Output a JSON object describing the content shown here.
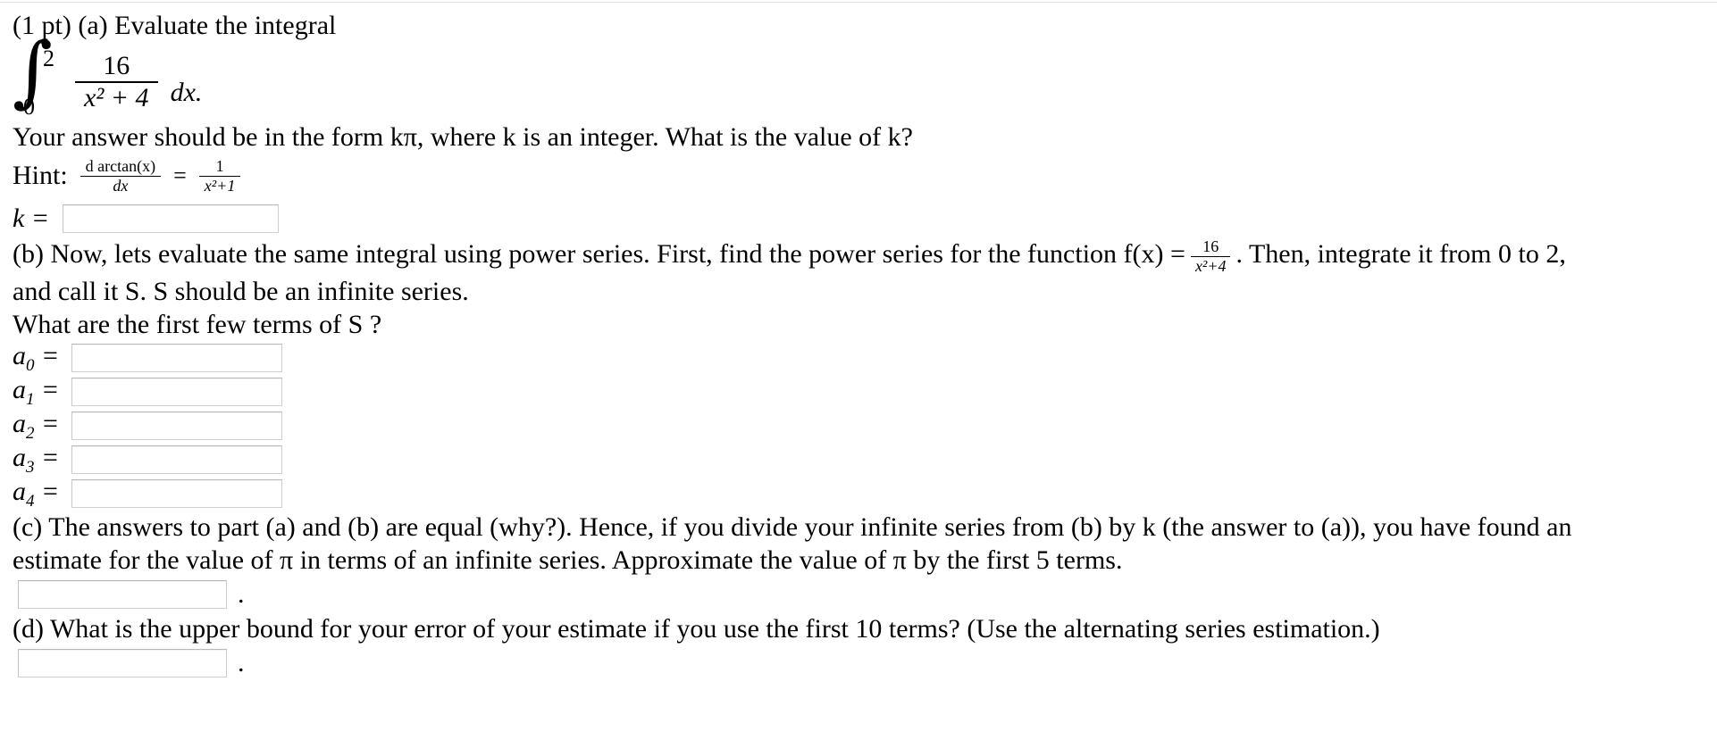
{
  "problem": {
    "points_label": "(1 pt)",
    "part_a": {
      "prompt": "(a) Evaluate the integral",
      "integral": {
        "sign": "∫",
        "lower_limit": "0",
        "upper_limit": "2",
        "numerator": "16",
        "denominator": "x² + 4",
        "differential": "dx."
      },
      "form_instruction": "Your answer should be in the form kπ, where k is an integer. What is the value of k?",
      "hint_label": "Hint:",
      "hint": {
        "left_numerator": "d arctan(x)",
        "left_denominator": "dx",
        "equals": "=",
        "right_numerator": "1",
        "right_denominator": "x²+1"
      },
      "answer_label": "k =",
      "answer_value": ""
    },
    "part_b": {
      "text_before_fraction": "(b) Now, lets evaluate the same integral using power series. First, find the power series for the function f(x) =",
      "fraction": {
        "numerator": "16",
        "denominator": "x²+4"
      },
      "text_after_fraction": ". Then, integrate it from 0 to 2,",
      "line2": "and call it S. S should be an infinite series.",
      "line3": "What are the first few terms of S ?",
      "coefficients": [
        {
          "label": "a",
          "subscript": "0",
          "equals": "=",
          "value": ""
        },
        {
          "label": "a",
          "subscript": "1",
          "equals": "=",
          "value": ""
        },
        {
          "label": "a",
          "subscript": "2",
          "equals": "=",
          "value": ""
        },
        {
          "label": "a",
          "subscript": "3",
          "equals": "=",
          "value": ""
        },
        {
          "label": "a",
          "subscript": "4",
          "equals": "=",
          "value": ""
        }
      ]
    },
    "part_c": {
      "line1": "(c) The answers to part (a) and (b) are equal (why?). Hence, if you divide your infinite series from (b) by k (the answer to (a)), you have found an",
      "line2": "estimate for the value of π in terms of an infinite series. Approximate the value of π by the first 5 terms.",
      "answer_value": "",
      "trailing_punctuation": "."
    },
    "part_d": {
      "line1": "(d) What is the upper bound for your error of your estimate if you use the first 10 terms? (Use the alternating series estimation.)",
      "answer_value": "",
      "trailing_punctuation": "."
    }
  },
  "style": {
    "page_background": "#ffffff",
    "text_color": "#000000",
    "input_border_color": "#cfcfcf",
    "top_rule_color": "#e3e3e3"
  }
}
